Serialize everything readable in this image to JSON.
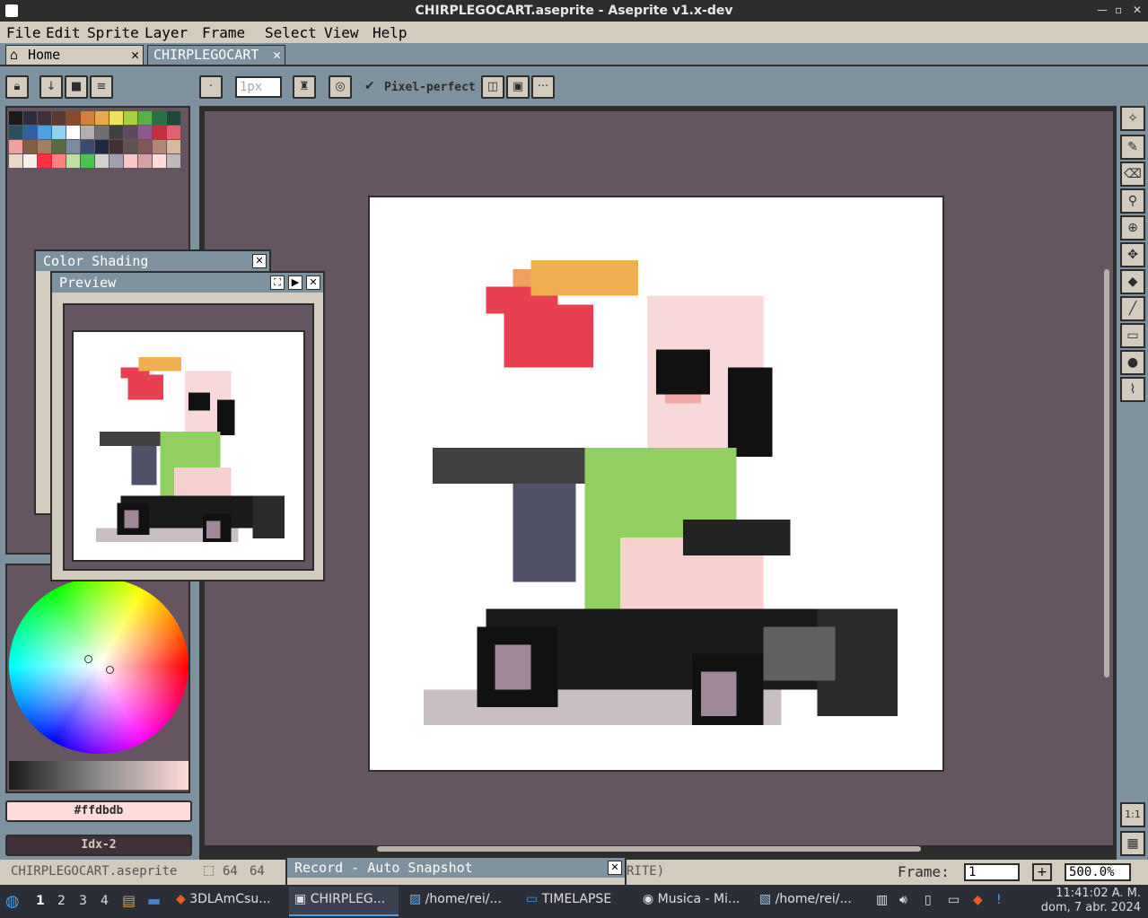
{
  "window": {
    "title": "CHIRPLEGOCART.aseprite - Aseprite v1.x-dev"
  },
  "menu": [
    "File",
    "Edit",
    "Sprite",
    "Layer",
    "Frame",
    "Select",
    "View",
    "Help"
  ],
  "tabs": {
    "home": "Home",
    "doc": "CHIRPLEGOCART"
  },
  "toolbar": {
    "brush_size": "1px",
    "pixel_perfect": "Pixel-perfect"
  },
  "color_shading_window": {
    "title": "Color Shading"
  },
  "preview_window": {
    "title": "Preview"
  },
  "colors": {
    "fg_hex": "#ffdbdb",
    "fg_label": "#ffdbdb",
    "bg_label": "Idx-2"
  },
  "palette": [
    "#1a1a1a",
    "#2d2d3d",
    "#40303a",
    "#5a3a30",
    "#8a4a2a",
    "#d08040",
    "#e8a850",
    "#f0e060",
    "#a8d040",
    "#58b048",
    "#2a7040",
    "#204838",
    "#2a5060",
    "#3060a0",
    "#50a0e0",
    "#90d0f0",
    "#ffffff",
    "#b0b0b0",
    "#707070",
    "#404040",
    "#604860",
    "#905890",
    "#c03040",
    "#e06070",
    "#f0a0a0",
    "#806040",
    "#a08060",
    "#5a6a40",
    "#7a8aa0",
    "#3a4a70",
    "#202840",
    "#403030",
    "#605050",
    "#805858",
    "#b08878",
    "#d8b8a0",
    "#e8d8c8",
    "#f8f0e8",
    "#ff3040",
    "#ff8080",
    "#c0e0a0",
    "#50c050",
    "#d0d0d0",
    "#a0a0b0",
    "#f8c8c8",
    "#d8a0a0",
    "#ffdbdb",
    "#bfb8b8"
  ],
  "record_window": {
    "title": "Record - Auto Snapshot"
  },
  "status": {
    "filename": "CHIRPLEGOCART.aseprite",
    "size_w": "64",
    "size_h": "64",
    "info_suffix": "RITE)",
    "frame_label": "Frame:",
    "frame_value": "1",
    "zoom": "500.0%"
  },
  "taskbar": {
    "workspaces": [
      "1",
      "2",
      "3",
      "4"
    ],
    "tasks": [
      "3DLAmCsu...",
      "CHIRPLEG...",
      "/home/rei/...",
      "TIMELAPSE",
      "Musica - Mi...",
      "/home/rei/..."
    ],
    "clock_time": "11:41:02 A. M.",
    "clock_date": "dom, 7 abr. 2024"
  }
}
